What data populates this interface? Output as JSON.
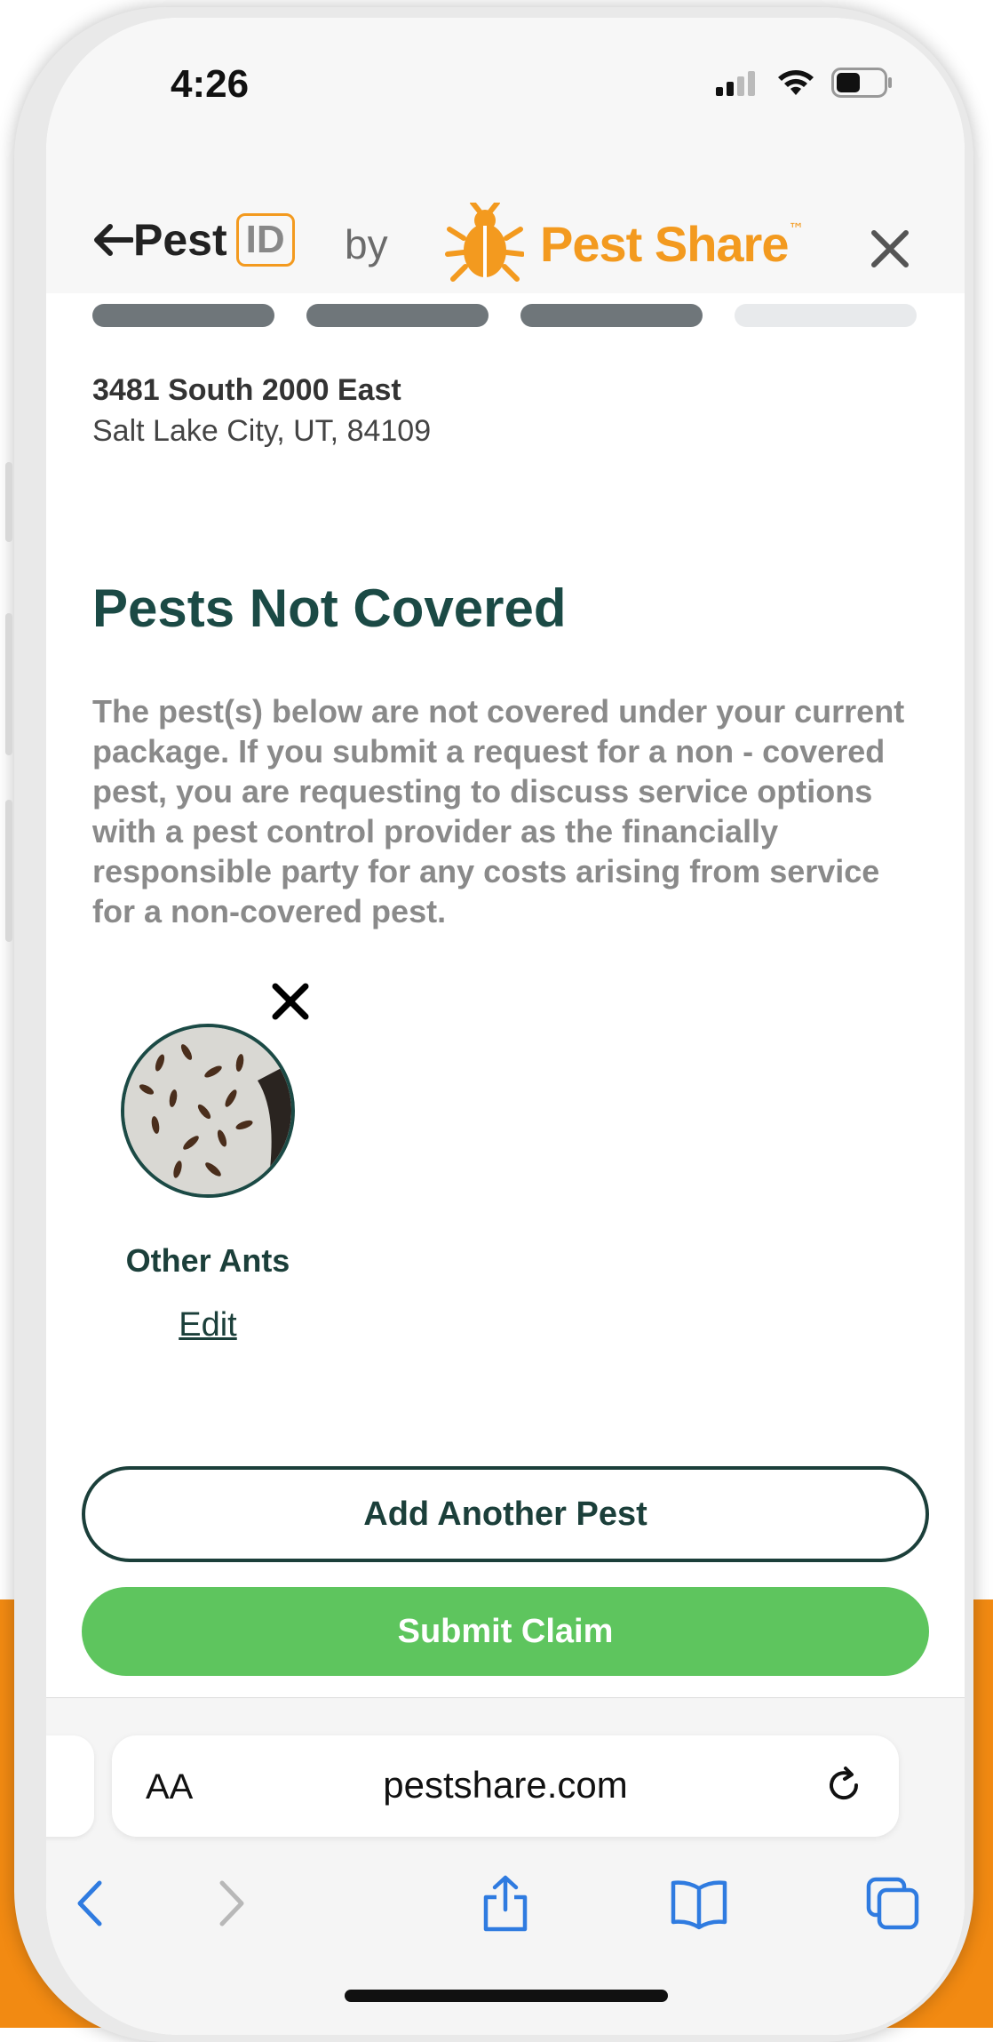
{
  "status": {
    "time": "4:26"
  },
  "header": {
    "logo_text": "Pest",
    "logo_id": "ID",
    "by": "by",
    "brand_name": "Pest Share",
    "brand_tm": "™"
  },
  "progress": {
    "total_steps": 4,
    "completed_steps": 3,
    "active_color": "#6f767a",
    "inactive_color": "#e8eaec"
  },
  "address": {
    "line1": "3481 South 2000 East",
    "line2": "Salt Lake City, UT, 84109"
  },
  "main": {
    "title": "Pests Not Covered",
    "description": "The pest(s) below are not covered under your current package. If you submit a request for a non - covered pest, you are requesting to discuss service options with a pest control provider as the financially responsible party for any costs arising from service for a non-covered pest.",
    "pests": [
      {
        "name": "Other Ants",
        "edit_label": "Edit"
      }
    ]
  },
  "actions": {
    "add_label": "Add Another Pest",
    "submit_label": "Submit Claim"
  },
  "safari": {
    "aa_label": "AA",
    "url": "pestshare.com"
  },
  "colors": {
    "brand_orange": "#f39a1f",
    "dark_green": "#1b4a45",
    "submit_green": "#5ec55e",
    "link_blue": "#2f7be0"
  }
}
